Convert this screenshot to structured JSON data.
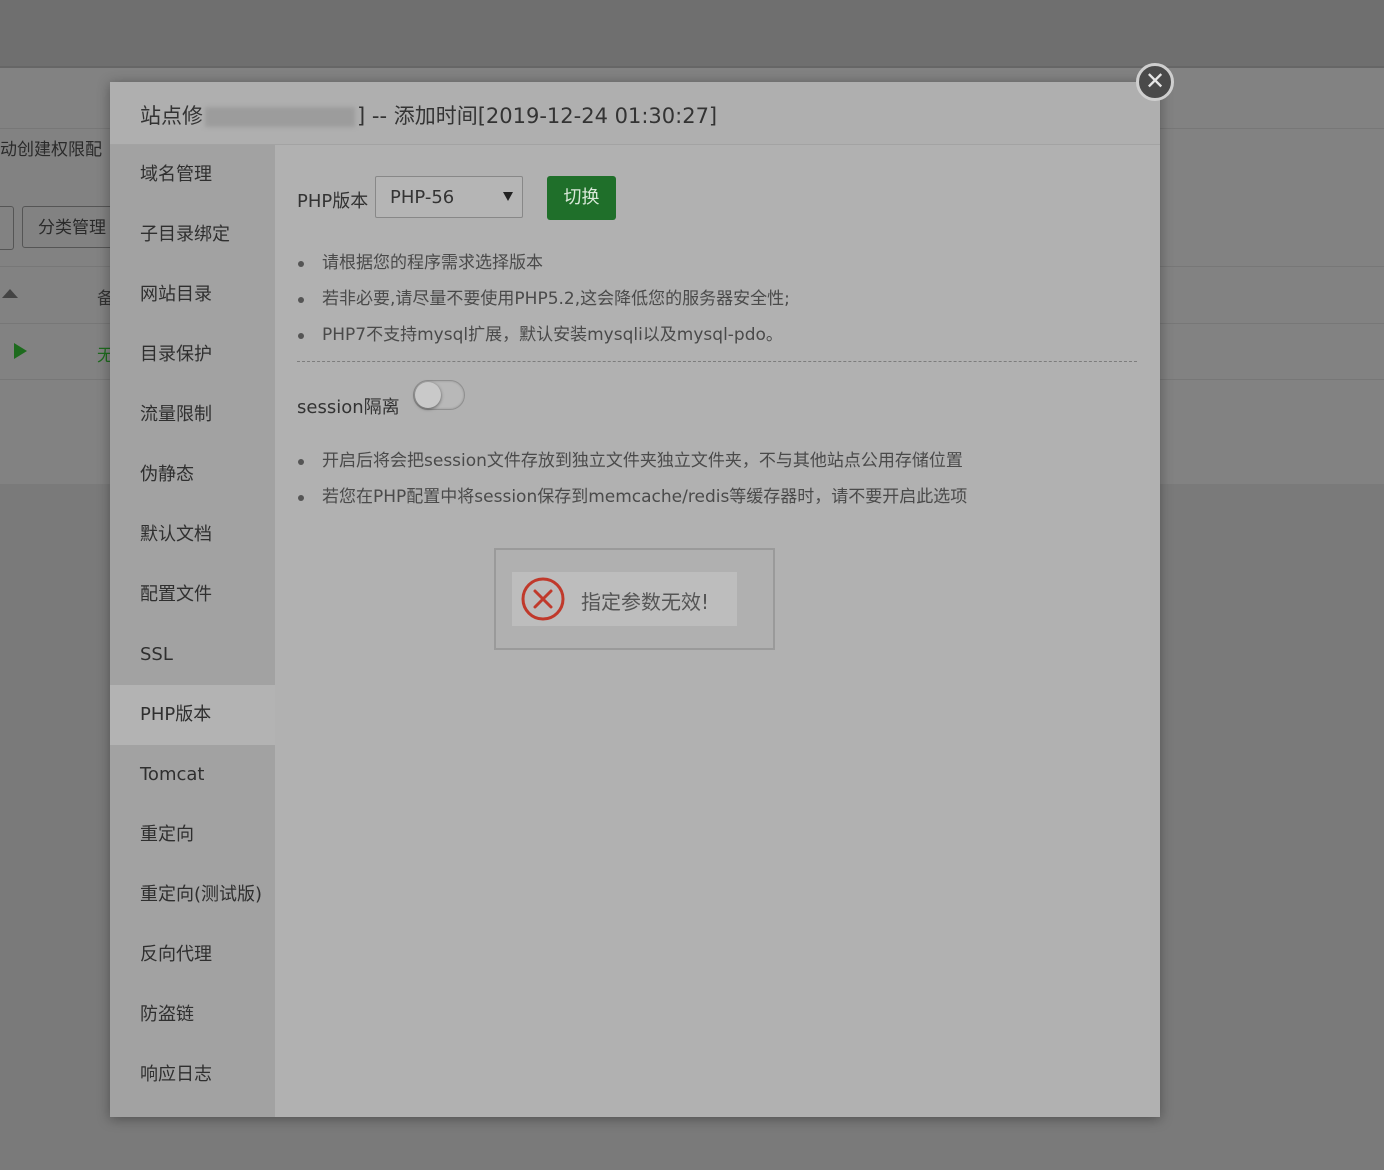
{
  "background": {
    "toolbar_label": "动创建权限配",
    "category_button": "分类管理",
    "table_header_partial": "备",
    "row_status_partial": "无"
  },
  "modal": {
    "title_prefix": "站点修",
    "title_suffix": "] -- 添加时间[2019-12-24 01:30:27]",
    "close_symbol": "✕"
  },
  "sidebar": {
    "items": [
      {
        "label": "域名管理"
      },
      {
        "label": "子目录绑定"
      },
      {
        "label": "网站目录"
      },
      {
        "label": "目录保护"
      },
      {
        "label": "流量限制"
      },
      {
        "label": "伪静态"
      },
      {
        "label": "默认文档"
      },
      {
        "label": "配置文件"
      },
      {
        "label": "SSL"
      },
      {
        "label": "PHP版本",
        "active": true
      },
      {
        "label": "Tomcat"
      },
      {
        "label": "重定向"
      },
      {
        "label": "重定向(测试版)"
      },
      {
        "label": "反向代理"
      },
      {
        "label": "防盗链"
      },
      {
        "label": "响应日志"
      }
    ]
  },
  "php": {
    "label": "PHP版本",
    "selected": "PHP-56",
    "switch_label": "切换",
    "switch_color": "#1f6f2a",
    "tips": [
      "请根据您的程序需求选择版本",
      "若非必要,请尽量不要使用PHP5.2,这会降低您的服务器安全性;",
      "PHP7不支持mysql扩展，默认安装mysqli以及mysql-pdo。"
    ]
  },
  "session": {
    "label": "session隔离",
    "enabled": false,
    "tips": [
      "开启后将会把session文件存放到独立文件夹独立文件夹，不与其他站点公用存储位置",
      "若您在PHP配置中将session保存到memcache/redis等缓存器时，请不要开启此选项"
    ]
  },
  "toast": {
    "icon": "error-x-circle-icon",
    "message": "指定参数无效!",
    "icon_color": "#c0392b"
  }
}
